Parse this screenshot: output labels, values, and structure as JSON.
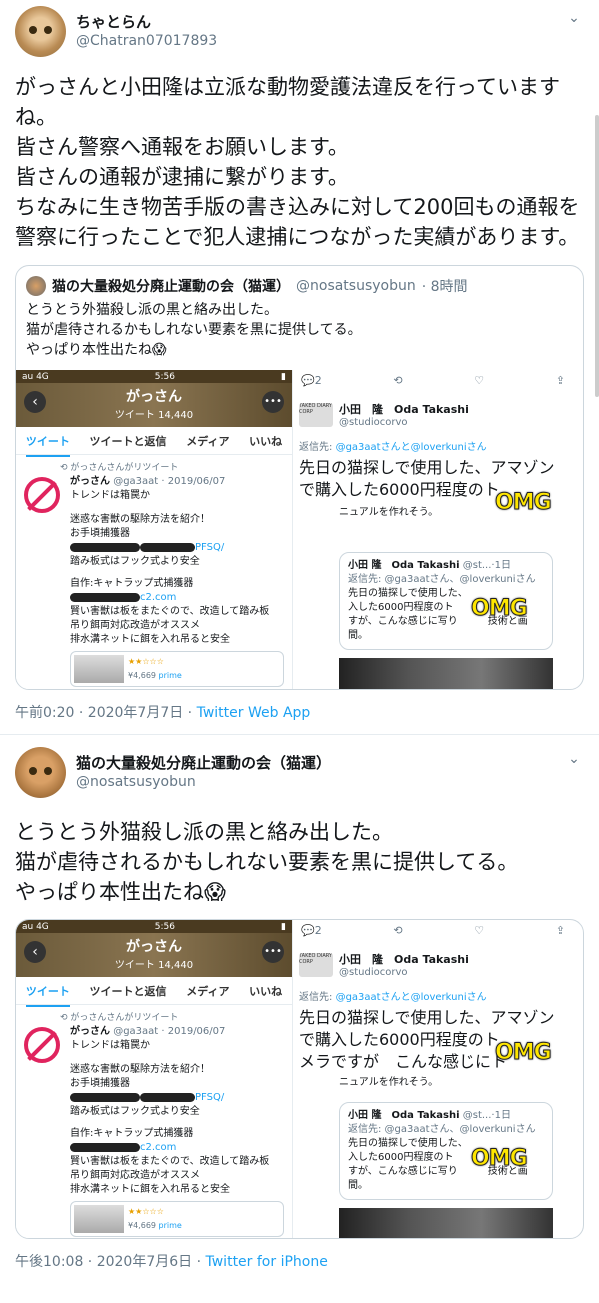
{
  "tweet1": {
    "display_name": "ちゃとらん",
    "handle": "@Chatran07017893",
    "text": "がっさんと小田隆は立派な動物愛護法違反を行っていますね。\n皆さん警察へ通報をお願いします。\n皆さんの通報が逮捕に繋がります。\nちなみに生き物苦手版の書き込みに対して200回もの通報を警察に行ったことで犯人逮捕につながった実績があります。",
    "timestamp": "午前0:20 · 2020年7月7日 · ",
    "source": "Twitter Web App",
    "quote": {
      "display_name": "猫の大量殺処分廃止運動の会（猫運）",
      "handle": "@nosatsusyobun",
      "time": "· 8時間",
      "text": "とうとう外猫殺し派の黒と絡み出した。\n猫が虐待されるかもしれない要素を黒に提供してる。\nやっぱり本性出たね😱"
    }
  },
  "tweet2": {
    "display_name": "猫の大量殺処分廃止運動の会（猫運）",
    "handle": "@nosatsusyobun",
    "text": "とうとう外猫殺し派の黒と絡み出した。\n猫が虐待されるかもしれない要素を黒に提供してる。\nやっぱり本性出たね😱",
    "timestamp": "午後10:08 · 2020年7月6日 · ",
    "source": "Twitter for iPhone"
  },
  "screenshot": {
    "status_left": "au 4G",
    "status_time": "5:56",
    "profile_name": "がっさん",
    "profile_count": "ツイート 14,440",
    "tabs": [
      "ツイート",
      "ツイートと返信",
      "メディア",
      "いいね"
    ],
    "retweet_label": "がっさんさんがリツイート",
    "feed_name": "がっさん",
    "feed_meta": "@ga3aat · 2019/06/07",
    "feed_line1": "トレンドは箱罠か",
    "feed_line2": "迷惑な害獣の駆除方法を紹介！",
    "feed_line3": "お手頃捕獲器",
    "feed_link1_suffix": "PFSQ/",
    "feed_line4": "踏み板式はフック式より安全",
    "feed_line5": "自作:キャトラップ式捕獲器",
    "feed_link2_suffix": "c2.com",
    "feed_line6": "賢い害獣は板をまたぐので、改造して踏み板",
    "feed_line7": "吊り餌両対応改造がオススメ",
    "feed_line8": "排水溝ネットに餌を入れ吊ると安全",
    "thumb_price": "¥4,669",
    "thumb_prime": "prime",
    "reply_count": "2",
    "other_name": "小田　隆　Oda Takashi",
    "other_handle": "@studiocorvo",
    "reply_to_prefix": "返信先: ",
    "reply_to_users": "@ga3aatさんと@loverkuniさん",
    "other_text": "先日の猫探しで使用した、アマゾン\nで購入した6000円程度のト\nメラですが　こんな感じにト",
    "other_cont": "ニュアルを作れそう。",
    "inner_name": "小田 隆　Oda Takashi",
    "inner_handle": "@st...",
    "inner_time": "·1日",
    "inner_reply": "返信先: @ga3aatさん、@loverkuniさん",
    "inner_text": "先日の猫探しで使用した、\n入した6000円程度のト\nすが、こんな感じに写り　　　技術と画\n間。",
    "omg": "OMG",
    "logo_caption": "TAKEO DIARY CORP"
  }
}
